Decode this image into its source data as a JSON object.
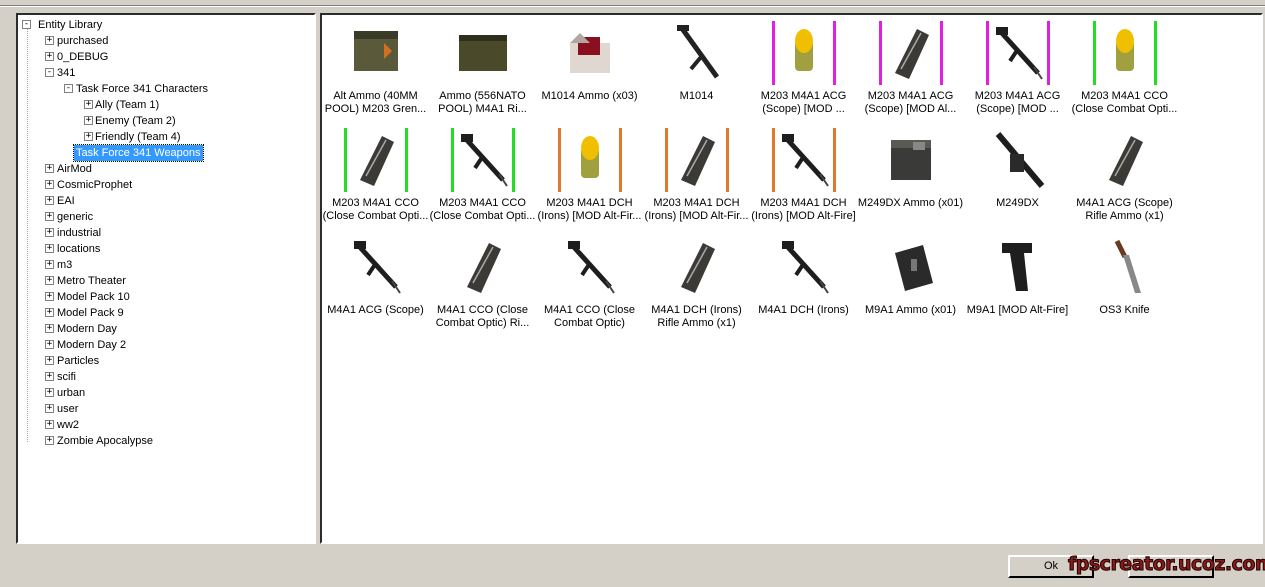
{
  "tree": {
    "root": "Entity Library",
    "nodes": [
      {
        "label": "purchased",
        "level": 1,
        "exp": "+"
      },
      {
        "label": "0_DEBUG",
        "level": 1,
        "exp": "+"
      },
      {
        "label": "341",
        "level": 1,
        "exp": "-"
      },
      {
        "label": "Task Force 341 Characters",
        "level": 2,
        "exp": "-"
      },
      {
        "label": "Ally (Team 1)",
        "level": 3,
        "exp": "+"
      },
      {
        "label": "Enemy (Team 2)",
        "level": 3,
        "exp": "+"
      },
      {
        "label": "Friendly (Team 4)",
        "level": 3,
        "exp": "+"
      },
      {
        "label": "Task Force 341 Weapons",
        "level": 2,
        "exp": "",
        "selected": true
      },
      {
        "label": "AirMod",
        "level": 1,
        "exp": "+"
      },
      {
        "label": "CosmicProphet",
        "level": 1,
        "exp": "+"
      },
      {
        "label": "EAI",
        "level": 1,
        "exp": "+"
      },
      {
        "label": "generic",
        "level": 1,
        "exp": "+"
      },
      {
        "label": "industrial",
        "level": 1,
        "exp": "+"
      },
      {
        "label": "locations",
        "level": 1,
        "exp": "+"
      },
      {
        "label": "m3",
        "level": 1,
        "exp": "+"
      },
      {
        "label": "Metro Theater",
        "level": 1,
        "exp": "+"
      },
      {
        "label": "Model Pack 10",
        "level": 1,
        "exp": "+"
      },
      {
        "label": "Model Pack 9",
        "level": 1,
        "exp": "+"
      },
      {
        "label": "Modern Day",
        "level": 1,
        "exp": "+"
      },
      {
        "label": "Modern Day 2",
        "level": 1,
        "exp": "+"
      },
      {
        "label": "Particles",
        "level": 1,
        "exp": "+"
      },
      {
        "label": "scifi",
        "level": 1,
        "exp": "+"
      },
      {
        "label": "urban",
        "level": 1,
        "exp": "+"
      },
      {
        "label": "user",
        "level": 1,
        "exp": "+"
      },
      {
        "label": "ww2",
        "level": 1,
        "exp": "+"
      },
      {
        "label": "Zombie Apocalypse",
        "level": 1,
        "exp": "+"
      }
    ]
  },
  "items": [
    {
      "l1": "Alt Ammo  (40MM",
      "l2": "POOL) M203 Gren...",
      "icon": "ammo-crate",
      "marker": ""
    },
    {
      "l1": "Ammo (556NATO",
      "l2": "POOL) M4A1 Ri...",
      "icon": "ammo-box",
      "marker": ""
    },
    {
      "l1": "M1014 Ammo (x03)",
      "l2": "",
      "icon": "shell-box",
      "marker": ""
    },
    {
      "l1": "M1014",
      "l2": "",
      "icon": "shotgun",
      "marker": ""
    },
    {
      "l1": "M203 M4A1 ACG",
      "l2": "(Scope) [MOD ...",
      "icon": "grenade-round",
      "marker": "#e020e0"
    },
    {
      "l1": "M203 M4A1 ACG",
      "l2": "(Scope) [MOD Al...",
      "icon": "magazine",
      "marker": "#e020e0"
    },
    {
      "l1": "M203 M4A1 ACG",
      "l2": "(Scope) [MOD ...",
      "icon": "rifle",
      "marker": "#e020e0"
    },
    {
      "l1": "M203 M4A1 CCO",
      "l2": "(Close Combat Opti...",
      "icon": "grenade-round",
      "marker": "#22dd22"
    },
    {
      "l1": "M203 M4A1 CCO",
      "l2": "(Close Combat Opti...",
      "icon": "magazine",
      "marker": "#22dd22"
    },
    {
      "l1": "M203 M4A1 CCO",
      "l2": "(Close Combat Opti...",
      "icon": "rifle",
      "marker": "#22dd22"
    },
    {
      "l1": "M203 M4A1 DCH",
      "l2": "(Irons) [MOD Alt-Fir...",
      "icon": "grenade-round",
      "marker": "#e07830"
    },
    {
      "l1": "M203 M4A1 DCH",
      "l2": "(Irons) [MOD Alt-Fir...",
      "icon": "magazine",
      "marker": "#e07830"
    },
    {
      "l1": "M203 M4A1 DCH",
      "l2": "(Irons) [MOD Alt-Fire]",
      "icon": "rifle",
      "marker": "#e07830"
    },
    {
      "l1": "M249DX Ammo (x01)",
      "l2": "",
      "icon": "ammo-can",
      "marker": ""
    },
    {
      "l1": "M249DX",
      "l2": "",
      "icon": "machine-gun",
      "marker": ""
    },
    {
      "l1": "M4A1 ACG (Scope)",
      "l2": "Rifle Ammo (x1)",
      "icon": "magazine",
      "marker": ""
    },
    {
      "l1": "M4A1 ACG (Scope)",
      "l2": "",
      "icon": "rifle",
      "marker": ""
    },
    {
      "l1": "M4A1 CCO (Close",
      "l2": "Combat Optic) Ri...",
      "icon": "magazine",
      "marker": ""
    },
    {
      "l1": "M4A1 CCO (Close",
      "l2": "Combat Optic)",
      "icon": "rifle",
      "marker": ""
    },
    {
      "l1": "M4A1 DCH (Irons)",
      "l2": "Rifle Ammo (x1)",
      "icon": "magazine",
      "marker": ""
    },
    {
      "l1": "M4A1 DCH (Irons)",
      "l2": "",
      "icon": "rifle",
      "marker": ""
    },
    {
      "l1": "M9A1 Ammo (x01)",
      "l2": "",
      "icon": "pistol-magazine",
      "marker": ""
    },
    {
      "l1": "M9A1 [MOD Alt-Fire]",
      "l2": "",
      "icon": "pistol",
      "marker": ""
    },
    {
      "l1": "OS3 Knife",
      "l2": "",
      "icon": "knife",
      "marker": ""
    }
  ],
  "buttons": {
    "ok": "Ok",
    "second": ""
  },
  "watermark": "fpscreator.ucoz.com"
}
